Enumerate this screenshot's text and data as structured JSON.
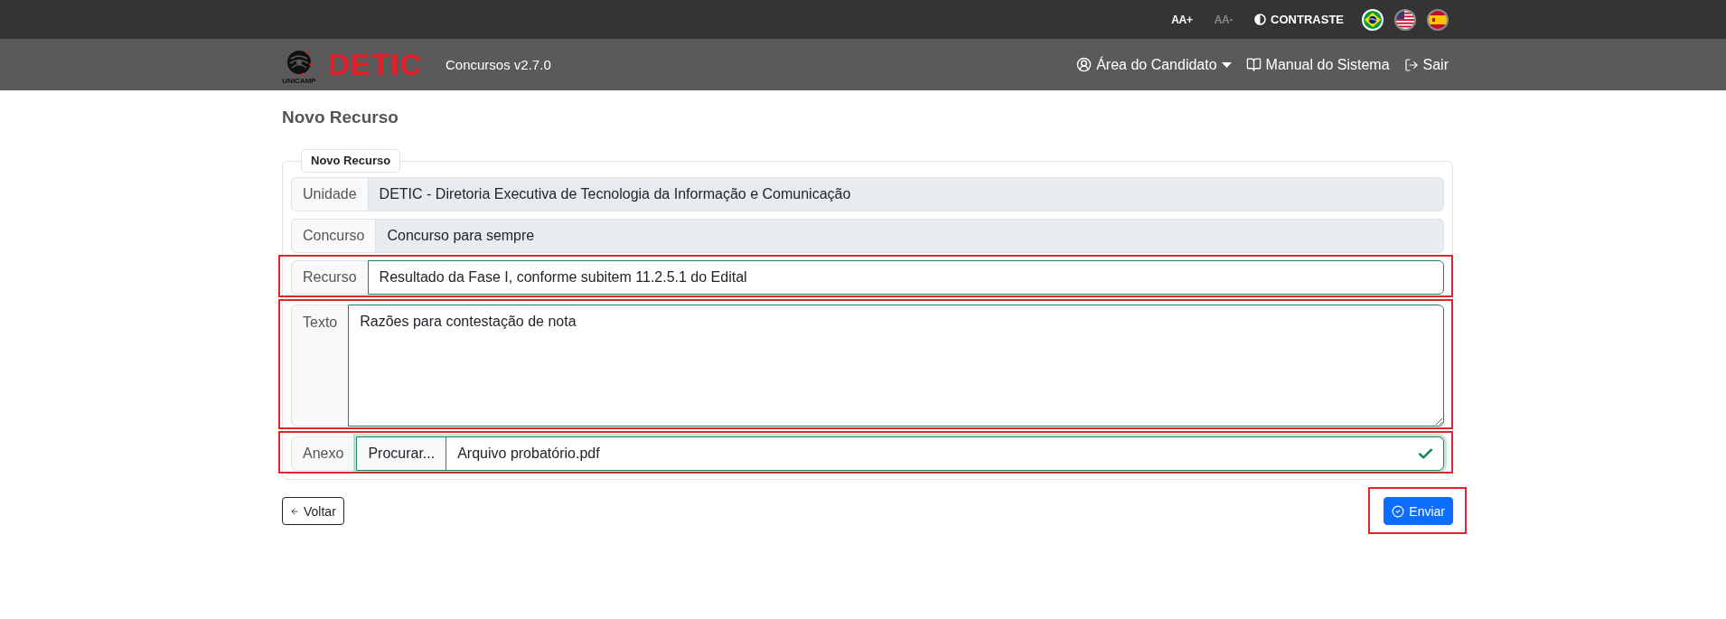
{
  "accessibility_bar": {
    "font_increase": {
      "label": "AA+",
      "disabled": false
    },
    "font_decrease": {
      "label": "AA-",
      "disabled": true
    },
    "contrast": {
      "label": "CONTRASTE"
    },
    "languages": [
      {
        "kind": "brazil",
        "selected": true
      },
      {
        "kind": "usa",
        "selected": false
      },
      {
        "kind": "spain",
        "selected": false
      }
    ]
  },
  "navbar": {
    "logo": {
      "caption": "UNICAMP",
      "wordmark": "DETIC"
    },
    "app_name": "Concursos v2.7.0",
    "links": [
      {
        "kind": "account",
        "label": "Área do Candidato",
        "dropdown": true
      },
      {
        "kind": "manual",
        "label": "Manual do Sistema",
        "dropdown": false
      },
      {
        "kind": "logout",
        "label": "Sair",
        "dropdown": false
      }
    ]
  },
  "page_title": "Novo Recurso",
  "form": {
    "legend": "Novo Recurso",
    "fields": [
      {
        "kind": "text",
        "label": "Unidade",
        "value": "DETIC - Diretoria Executiva de Tecnologia da Informação e Comunicação",
        "disabled": true,
        "valid": false,
        "highlighted": false
      },
      {
        "kind": "text",
        "label": "Concurso",
        "value": "Concurso para sempre",
        "disabled": true,
        "valid": false,
        "highlighted": false
      },
      {
        "kind": "text",
        "label": "Recurso",
        "value": "Resultado da Fase I, conforme subitem 11.2.5.1 do Edital",
        "disabled": false,
        "valid": true,
        "highlighted": true
      },
      {
        "kind": "textarea",
        "label": "Texto",
        "value": "Razões para contestação de nota",
        "disabled": false,
        "valid": true,
        "highlighted": true
      },
      {
        "kind": "file",
        "label": "Anexo",
        "button_label": "Procurar...",
        "value": "Arquivo probatório.pdf",
        "disabled": false,
        "valid": true,
        "highlighted": true
      }
    ]
  },
  "actions": [
    {
      "kind": "back",
      "label": "Voltar",
      "highlighted": false
    },
    {
      "kind": "submit",
      "label": "Enviar",
      "highlighted": true
    }
  ]
}
